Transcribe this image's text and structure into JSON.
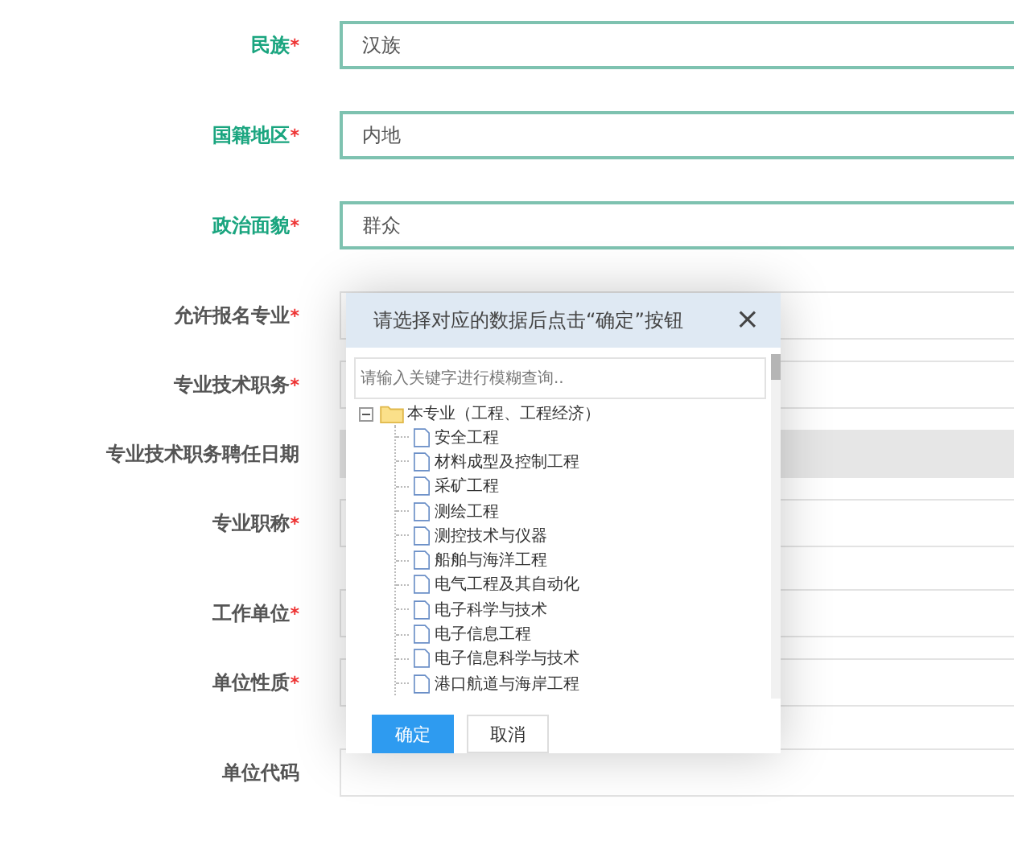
{
  "form": {
    "rows": [
      {
        "label": "民族",
        "required_mark": "*",
        "highlighted": true,
        "value": "汉族",
        "disabled": false
      },
      {
        "label": "国籍地区",
        "required_mark": "*",
        "highlighted": true,
        "value": "内地",
        "disabled": false
      },
      {
        "label": "政治面貌",
        "required_mark": "*",
        "highlighted": true,
        "value": "群众",
        "disabled": false
      },
      {
        "label": "允许报名专业",
        "required_mark": "*",
        "highlighted": false,
        "disabled": false
      },
      {
        "label": "专业技术职务",
        "required_mark": "*",
        "highlighted": false,
        "disabled": false
      },
      {
        "label": "专业技术职务聘任日期",
        "highlighted": false,
        "disabled": true
      },
      {
        "label": "专业职称",
        "required_mark": "*",
        "highlighted": false,
        "disabled": false
      },
      {
        "label": "工作单位",
        "required_mark": "*",
        "highlighted": false,
        "disabled": false
      },
      {
        "label": "单位性质",
        "required_mark": "*",
        "highlighted": false,
        "disabled": false
      },
      {
        "label": "单位代码",
        "highlighted": false,
        "disabled": false
      }
    ]
  },
  "dialog": {
    "title": "请选择对应的数据后点击“确定”按钮",
    "close": "×",
    "search": {
      "placeholder": "请输入关键字进行模糊查询.."
    },
    "tree": [
      {
        "label": "本专业（工程、工程经济）",
        "expanded": true,
        "children": [
          {
            "label": "安全工程"
          },
          {
            "label": "材料成型及控制工程"
          },
          {
            "label": "采矿工程"
          },
          {
            "label": "测绘工程"
          },
          {
            "label": "测控技术与仪器"
          },
          {
            "label": "船舶与海洋工程"
          },
          {
            "label": "电气工程及其自动化"
          },
          {
            "label": "电子科学与技术"
          },
          {
            "label": "电子信息工程"
          },
          {
            "label": "电子信息科学与技术"
          },
          {
            "label": "港口航道与海岸工程"
          }
        ]
      }
    ],
    "buttons": [
      {
        "label": "确定",
        "kind": "primary"
      },
      {
        "label": "取消",
        "kind": "secondary"
      }
    ]
  }
}
